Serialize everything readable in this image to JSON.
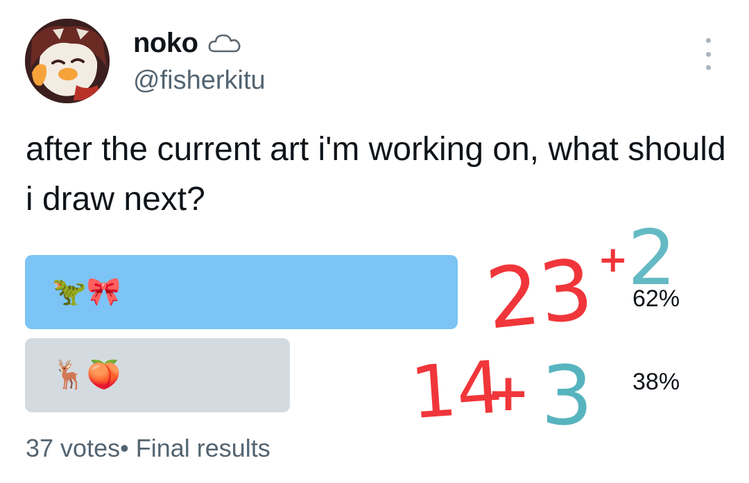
{
  "author": {
    "display_name": "noko",
    "handle": "@fisherkitu",
    "avatar_icon": "avatar-illustration-icon",
    "badge_icon": "cloud-icon"
  },
  "tweet": {
    "text": "after the current art i'm working on, what should i draw next?"
  },
  "poll": {
    "options": [
      {
        "label": "🦖🎀",
        "percent_text": "62%",
        "percent": 62,
        "winner": true,
        "color": "#7cc4f5"
      },
      {
        "label": "🦌🍑",
        "percent_text": "38%",
        "percent": 38,
        "winner": false,
        "color": "#d4dbe0"
      }
    ],
    "votes_text": "37 votes",
    "status_text": "• Final results"
  },
  "annotations": {
    "top": {
      "count": "23",
      "plus": "+",
      "extra": "2"
    },
    "bottom": {
      "count": "14",
      "plus": "+",
      "extra": "3"
    },
    "red_color": "#f0363a",
    "teal_color": "#57b4bf"
  },
  "menu_icon": "more-options-icon"
}
